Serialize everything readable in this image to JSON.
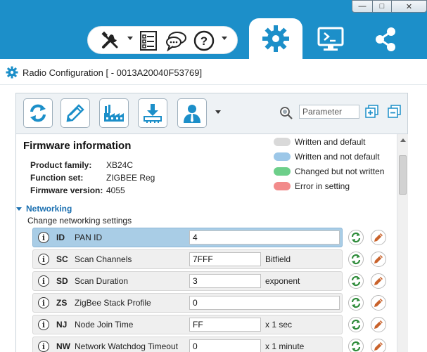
{
  "window": {
    "minimize_glyph": "—",
    "maximize_glyph": "□",
    "close_glyph": "✕"
  },
  "toolbar": {
    "tools": [
      {
        "name": "tools-icon"
      },
      {
        "name": "profile-list-icon"
      },
      {
        "name": "chat-icon"
      },
      {
        "name": "help-icon"
      }
    ],
    "modes": [
      {
        "name": "configuration-gear-icon",
        "active": true
      },
      {
        "name": "console-terminal-icon",
        "active": false
      },
      {
        "name": "network-nodes-icon",
        "active": false
      }
    ]
  },
  "panel": {
    "title": "Radio Configuration [  - 0013A20040F53769]"
  },
  "rc_toolbar": {
    "buttons": [
      "read-icon",
      "write-icon",
      "factory-defaults-icon",
      "update-firmware-icon",
      "profile-icon"
    ],
    "search_placeholder": "Parameter"
  },
  "firmware": {
    "title": "Firmware information",
    "rows": [
      {
        "label": "Product family:",
        "value": "XB24C"
      },
      {
        "label": "Function set:",
        "value": "ZIGBEE Reg"
      },
      {
        "label": "Firmware version:",
        "value": "4055"
      }
    ]
  },
  "legend": [
    {
      "label": "Written and default",
      "color": "#d9d9d9"
    },
    {
      "label": "Written and not default",
      "color": "#9cc7e8"
    },
    {
      "label": "Changed but not written",
      "color": "#6dcf8a"
    },
    {
      "label": "Error in setting",
      "color": "#f28b8b"
    }
  ],
  "section": {
    "title": "Networking",
    "subtitle": "Change networking settings"
  },
  "params": [
    {
      "code": "ID",
      "name": "PAN ID",
      "value": "4",
      "unit": "",
      "selected": true
    },
    {
      "code": "SC",
      "name": "Scan Channels",
      "value": "7FFF",
      "unit": "Bitfield",
      "selected": false
    },
    {
      "code": "SD",
      "name": "Scan Duration",
      "value": "3",
      "unit": "exponent",
      "selected": false
    },
    {
      "code": "ZS",
      "name": "ZigBee Stack Profile",
      "value": "0",
      "unit": "",
      "selected": false
    },
    {
      "code": "NJ",
      "name": "Node Join Time",
      "value": "FF",
      "unit": "x 1 sec",
      "selected": false
    },
    {
      "code": "NW",
      "name": "Network Watchdog Timeout",
      "value": "0",
      "unit": "x 1 minute",
      "selected": false
    }
  ],
  "colors": {
    "brand_blue": "#1c8fc9",
    "selected_row": "#a9cde6",
    "read_green": "#2e8b3a",
    "write_orange": "#c9622b"
  }
}
